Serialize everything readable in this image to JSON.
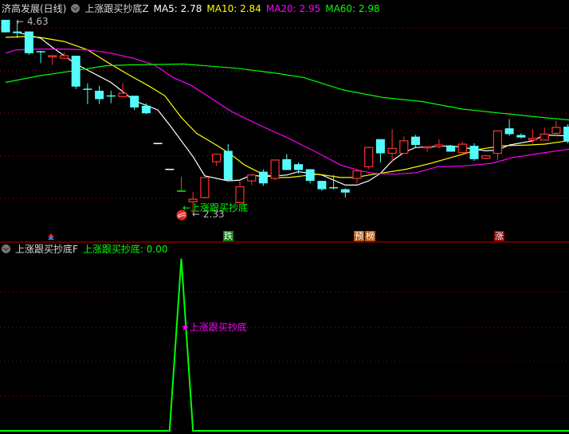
{
  "header": {
    "stock_name": "济高发展(日线)",
    "indicator_main": "上涨跟买抄底Z",
    "ma5_label": "MA5: 2.78",
    "ma10_label": "MA10: 2.84",
    "ma20_label": "MA20: 2.95",
    "ma60_label": "MA60: 2.98"
  },
  "sub_header": {
    "indicator_sub": "上涨跟买抄底F",
    "value_label": "上涨跟买抄底: 0.00"
  },
  "annotations": {
    "high_label": "4.63",
    "low_label": "2.33",
    "buy_signal_text": "←上涨跟买抄底",
    "sub_signal_text": "★上涨跟买抄底",
    "tag_fall": "跌",
    "tag_pre1": "预",
    "tag_pre2": "榜",
    "tag_rise": "涨"
  },
  "colors": {
    "up": "#ff3232",
    "down": "#54fcfc",
    "ma5": "#ffffff",
    "ma10": "#ffff00",
    "ma20": "#ff00ff",
    "ma60": "#00ff00",
    "grid": "#a01010",
    "signal": "#00ff00",
    "signal_label": "#ff00ff"
  },
  "chart_data": [
    {
      "type": "candlestick",
      "x_unit": "bar index",
      "ylim": [
        2.33,
        4.63
      ],
      "grid": true,
      "candles": [
        [
          4.65,
          4.65,
          4.5,
          4.5
        ],
        [
          4.51,
          4.63,
          4.43,
          4.49
        ],
        [
          4.51,
          4.51,
          4.23,
          4.25
        ],
        [
          4.27,
          4.28,
          4.13,
          4.26
        ],
        [
          4.21,
          4.23,
          4.11,
          4.22
        ],
        [
          4.19,
          4.26,
          4.18,
          4.22
        ],
        [
          4.22,
          4.22,
          3.82,
          3.85
        ],
        [
          3.82,
          3.89,
          3.64,
          3.81
        ],
        [
          3.8,
          3.86,
          3.64,
          3.7
        ],
        [
          3.74,
          3.8,
          3.65,
          3.73
        ],
        [
          3.73,
          3.89,
          3.72,
          3.77
        ],
        [
          3.74,
          3.74,
          3.57,
          3.6
        ],
        [
          3.62,
          3.65,
          3.52,
          3.53
        ],
        [
          3.17,
          3.17,
          3.17,
          3.17
        ],
        [
          2.86,
          2.86,
          2.86,
          2.86
        ],
        [
          2.6,
          2.77,
          2.59,
          2.59
        ],
        [
          2.47,
          2.59,
          2.33,
          2.5
        ],
        [
          2.52,
          2.76,
          2.51,
          2.76
        ],
        [
          2.95,
          3.04,
          2.9,
          3.04
        ],
        [
          3.08,
          3.16,
          2.73,
          2.73
        ],
        [
          2.46,
          2.72,
          2.46,
          2.65
        ],
        [
          2.72,
          2.79,
          2.67,
          2.79
        ],
        [
          2.83,
          2.86,
          2.66,
          2.69
        ],
        [
          2.75,
          2.97,
          2.73,
          2.97
        ],
        [
          2.98,
          3.04,
          2.85,
          2.85
        ],
        [
          2.92,
          2.94,
          2.81,
          2.85
        ],
        [
          2.86,
          2.86,
          2.69,
          2.72
        ],
        [
          2.72,
          2.72,
          2.6,
          2.62
        ],
        [
          2.64,
          2.79,
          2.62,
          2.63
        ],
        [
          2.62,
          2.63,
          2.52,
          2.58
        ],
        [
          2.75,
          2.84,
          2.69,
          2.84
        ],
        [
          2.89,
          3.13,
          2.86,
          3.12
        ],
        [
          3.22,
          3.22,
          2.94,
          3.05
        ],
        [
          3.05,
          3.34,
          2.94,
          3.11
        ],
        [
          3.05,
          3.25,
          3.05,
          3.2
        ],
        [
          3.25,
          3.27,
          3.12,
          3.15
        ],
        [
          3.12,
          3.13,
          3.07,
          3.13
        ],
        [
          3.13,
          3.22,
          3.11,
          3.15
        ],
        [
          3.14,
          3.15,
          3.07,
          3.07
        ],
        [
          3.06,
          3.19,
          3.05,
          3.16
        ],
        [
          3.14,
          3.17,
          2.96,
          2.98
        ],
        [
          2.99,
          3.03,
          2.98,
          3.02
        ],
        [
          3.05,
          3.32,
          2.97,
          3.32
        ],
        [
          3.35,
          3.46,
          3.26,
          3.28
        ],
        [
          3.27,
          3.29,
          3.23,
          3.24
        ],
        [
          3.21,
          3.34,
          3.17,
          3.23
        ],
        [
          3.21,
          3.36,
          3.21,
          3.28
        ],
        [
          3.29,
          3.44,
          3.26,
          3.36
        ],
        [
          3.37,
          3.4,
          3.17,
          3.19
        ]
      ],
      "candle_color_overrides": {
        "14": "#ffffff",
        "15": "#ffffff",
        "16": "#00ff00"
      },
      "series": [
        {
          "name": "MA5",
          "points": [
            [
              2,
              4.5
            ],
            [
              4,
              4.43
            ],
            [
              5,
              4.32
            ],
            [
              7,
              4.12
            ],
            [
              10,
              3.9
            ],
            [
              12,
              3.68
            ],
            [
              14,
              3.57
            ],
            [
              15,
              3.39
            ],
            [
              17,
              3.01
            ],
            [
              18,
              2.78
            ],
            [
              20,
              2.72
            ],
            [
              21,
              2.73
            ],
            [
              22,
              2.79
            ],
            [
              23,
              2.77
            ],
            [
              25,
              2.79
            ],
            [
              26,
              2.83
            ],
            [
              28,
              2.79
            ],
            [
              30,
              2.67
            ],
            [
              31,
              2.67
            ],
            [
              32,
              2.72
            ],
            [
              33,
              2.81
            ],
            [
              34,
              2.96
            ],
            [
              35,
              3.06
            ],
            [
              36,
              3.12
            ],
            [
              39,
              3.14
            ],
            [
              42,
              3.08
            ],
            [
              43,
              3.09
            ],
            [
              44,
              3.15
            ],
            [
              46,
              3.2
            ],
            [
              47,
              3.27
            ],
            [
              49,
              3.26
            ]
          ]
        },
        {
          "name": "MA10",
          "points": [
            [
              1,
              4.44
            ],
            [
              2.6,
              4.45
            ],
            [
              3.9,
              4.44
            ],
            [
              6,
              4.39
            ],
            [
              8,
              4.29
            ],
            [
              9.6,
              4.15
            ],
            [
              11.4,
              4.0
            ],
            [
              13.2,
              3.86
            ],
            [
              14.6,
              3.74
            ],
            [
              16,
              3.48
            ],
            [
              17.3,
              3.29
            ],
            [
              19.1,
              3.14
            ],
            [
              20.3,
              3.03
            ],
            [
              21.4,
              2.91
            ],
            [
              22.8,
              2.81
            ],
            [
              24.1,
              2.76
            ],
            [
              25.2,
              2.76
            ],
            [
              26.4,
              2.78
            ],
            [
              27.7,
              2.8
            ],
            [
              29.6,
              2.76
            ],
            [
              30.9,
              2.76
            ],
            [
              32,
              2.79
            ],
            [
              33.4,
              2.82
            ],
            [
              35.2,
              2.86
            ],
            [
              37.3,
              2.93
            ],
            [
              39.3,
              3.01
            ],
            [
              41.5,
              3.1
            ],
            [
              43.4,
              3.14
            ],
            [
              45.6,
              3.15
            ],
            [
              47,
              3.16
            ],
            [
              49,
              3.2
            ]
          ]
        },
        {
          "name": "MA20",
          "points": [
            [
              1,
              4.25
            ],
            [
              1.9,
              4.29
            ],
            [
              3.9,
              4.3
            ],
            [
              6.2,
              4.3
            ],
            [
              8,
              4.29
            ],
            [
              10,
              4.25
            ],
            [
              11.9,
              4.19
            ],
            [
              13.7,
              4.11
            ],
            [
              15.3,
              3.96
            ],
            [
              16.9,
              3.86
            ],
            [
              20.3,
              3.55
            ],
            [
              22.8,
              3.38
            ],
            [
              25,
              3.24
            ],
            [
              27.3,
              3.08
            ],
            [
              29.6,
              2.91
            ],
            [
              31.3,
              2.84
            ],
            [
              32.5,
              2.81
            ],
            [
              34.3,
              2.8
            ],
            [
              36.1,
              2.82
            ],
            [
              37.9,
              2.89
            ],
            [
              40.2,
              2.9
            ],
            [
              42.5,
              2.93
            ],
            [
              44.3,
              3.0
            ],
            [
              46.6,
              3.05
            ],
            [
              49.1,
              3.1
            ]
          ]
        },
        {
          "name": "MA60",
          "points": [
            [
              1,
              3.9
            ],
            [
              3.9,
              3.98
            ],
            [
              7.3,
              4.05
            ],
            [
              9.6,
              4.1
            ],
            [
              11.4,
              4.11
            ],
            [
              16.2,
              4.12
            ],
            [
              20.7,
              4.07
            ],
            [
              24.1,
              4.01
            ],
            [
              26.4,
              3.96
            ],
            [
              29.8,
              3.81
            ],
            [
              33.2,
              3.72
            ],
            [
              36.6,
              3.67
            ],
            [
              40,
              3.58
            ],
            [
              43.4,
              3.53
            ],
            [
              46.8,
              3.48
            ],
            [
              49.1,
              3.45
            ]
          ]
        }
      ]
    },
    {
      "type": "line",
      "name": "上涨跟买抄底",
      "x_unit": "bar index",
      "ylim": [
        0,
        1
      ],
      "grid": true,
      "signal_bar": 16,
      "values": [
        0,
        0,
        0,
        0,
        0,
        0,
        0,
        0,
        0,
        0,
        0,
        0,
        0,
        0,
        0,
        1,
        0,
        0,
        0,
        0,
        0,
        0,
        0,
        0,
        0,
        0,
        0,
        0,
        0,
        0,
        0,
        0,
        0,
        0,
        0,
        0,
        0,
        0,
        0,
        0,
        0,
        0,
        0,
        0,
        0,
        0,
        0,
        0,
        0
      ]
    }
  ]
}
